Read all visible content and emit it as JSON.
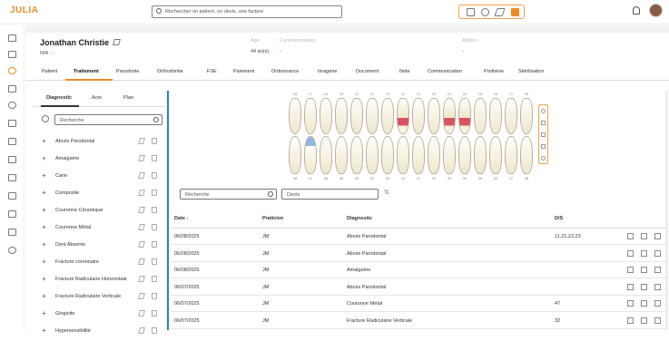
{
  "app": {
    "logo": "JULIA"
  },
  "search": {
    "placeholder": "Rechercher un patient, un devis, une facture"
  },
  "patient": {
    "name": "Jonathan Christie",
    "nir": "NIR : -"
  },
  "info": {
    "age_label": "Âge",
    "age_value": "44 an(s)",
    "char_label": "Caractéristiques",
    "char_value": "-",
    "alert_label": "Alertes",
    "alert_value": "-"
  },
  "tabs": [
    "Patient",
    "Traitement",
    "Parodonte",
    "Orthodontie",
    "FSE",
    "Paiement",
    "Ordonnance",
    "Imagerie",
    "Document",
    "Note",
    "Communication",
    "Prothèse",
    "Stérilisation"
  ],
  "subtabs": [
    "Diagnostic",
    "Acte",
    "Plan"
  ],
  "left_search": {
    "placeholder": "Recherche"
  },
  "diagnostics": [
    "Abcès Parodontal",
    "Amalgame",
    "Carie",
    "Composite",
    "Couronne Céramique",
    "Couronne Métal",
    "Dent Absente",
    "Fracture coronnaire",
    "Fracture Radiculaire Horizontale",
    "Fracture Radiculaire Verticale",
    "Gingivite",
    "Hypersensibilité"
  ],
  "chart": {
    "upper_numbers": [
      "18",
      "17",
      "16",
      "15",
      "14",
      "13",
      "12",
      "11",
      "21",
      "22",
      "23",
      "24",
      "25",
      "26",
      "27",
      "28"
    ],
    "lower_numbers": [
      "48",
      "47",
      "46",
      "45",
      "44",
      "43",
      "42",
      "41",
      "31",
      "32",
      "33",
      "34",
      "35",
      "36",
      "37",
      "38"
    ],
    "highlight_upper": [
      7,
      10,
      11
    ],
    "highlight_lower": [
      1
    ],
    "colors": {
      "red": "#d9545e",
      "blue": "#8fb8e6",
      "accent": "#f08a24"
    }
  },
  "filters": {
    "search_placeholder": "Recherche",
    "tooth_placeholder": "Dents"
  },
  "table": {
    "headers": {
      "date": "Date ↓",
      "practitioner": "Praticien",
      "diagnostic": "Diagnostic",
      "teeth": "D/S"
    },
    "rows": [
      {
        "date": "06/08/2025",
        "practitioner": "JM",
        "diagnostic": "Abcès Parodontal",
        "teeth": "11,21,22,23"
      },
      {
        "date": "06/08/2025",
        "practitioner": "JM",
        "diagnostic": "Abcès Parodontal",
        "teeth": ""
      },
      {
        "date": "06/08/2025",
        "practitioner": "JM",
        "diagnostic": "Amalgame",
        "teeth": ""
      },
      {
        "date": "06/07/2025",
        "practitioner": "JM",
        "diagnostic": "Abcès Parodontal",
        "teeth": ""
      },
      {
        "date": "06/07/2025",
        "practitioner": "JM",
        "diagnostic": "Couronne Métal",
        "teeth": "47"
      },
      {
        "date": "06/07/2025",
        "practitioner": "JM",
        "diagnostic": "Fracture Radiculaire Verticale",
        "teeth": "32"
      }
    ]
  }
}
